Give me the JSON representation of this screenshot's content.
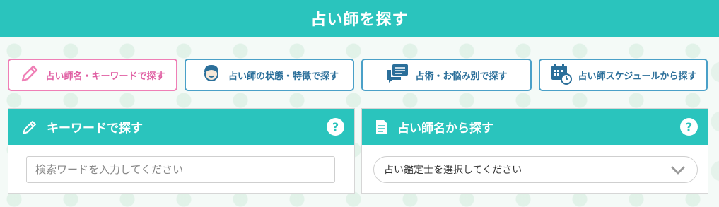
{
  "header": {
    "title": "占い師を探す"
  },
  "tabs": [
    {
      "label": "占い師名・キーワードで探す",
      "icon": "pencil-icon"
    },
    {
      "label": "占い師の状態・特徴で探す",
      "icon": "fortune-teller-icon"
    },
    {
      "label": "占術・お悩み別で探す",
      "icon": "chat-bubble-icon"
    },
    {
      "label": "占い師スケジュールから探す",
      "icon": "calendar-clock-icon"
    }
  ],
  "keyword_panel": {
    "title": "キーワードで探す",
    "help": "?",
    "placeholder": "検索ワードを入力してください",
    "value": ""
  },
  "name_panel": {
    "title": "占い師名から探す",
    "help": "?",
    "selected": "占い鑑定士を選択してください"
  },
  "colors": {
    "accent": "#2ac4bd",
    "tab_border": "#4aa0c8",
    "active_tab": "#ef7fb6"
  }
}
